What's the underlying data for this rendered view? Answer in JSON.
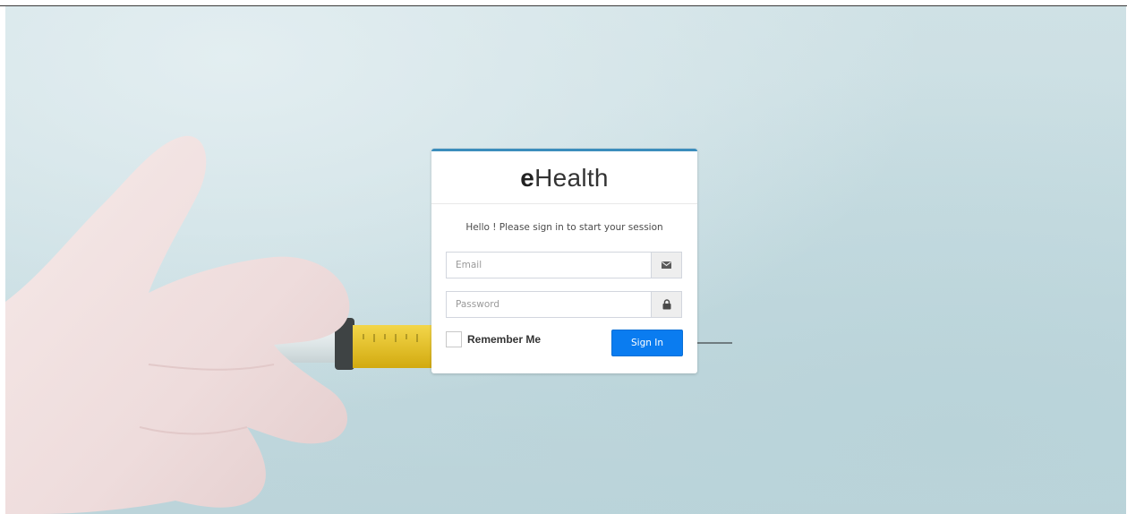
{
  "app": {
    "brand_prefix": "e",
    "brand_suffix": "Health",
    "accent_color": "#3c8dbc",
    "button_color": "#0a7cf0"
  },
  "login": {
    "message": "Hello ! Please sign in to start your session",
    "email": {
      "placeholder": "Email",
      "value": "",
      "icon": "envelope-icon"
    },
    "password": {
      "placeholder": "Password",
      "value": "",
      "icon": "lock-icon"
    },
    "remember_label": "Remember Me",
    "remember_checked": false,
    "submit_label": "Sign In"
  },
  "background": {
    "image": "gloved-hand-holding-syringe"
  }
}
